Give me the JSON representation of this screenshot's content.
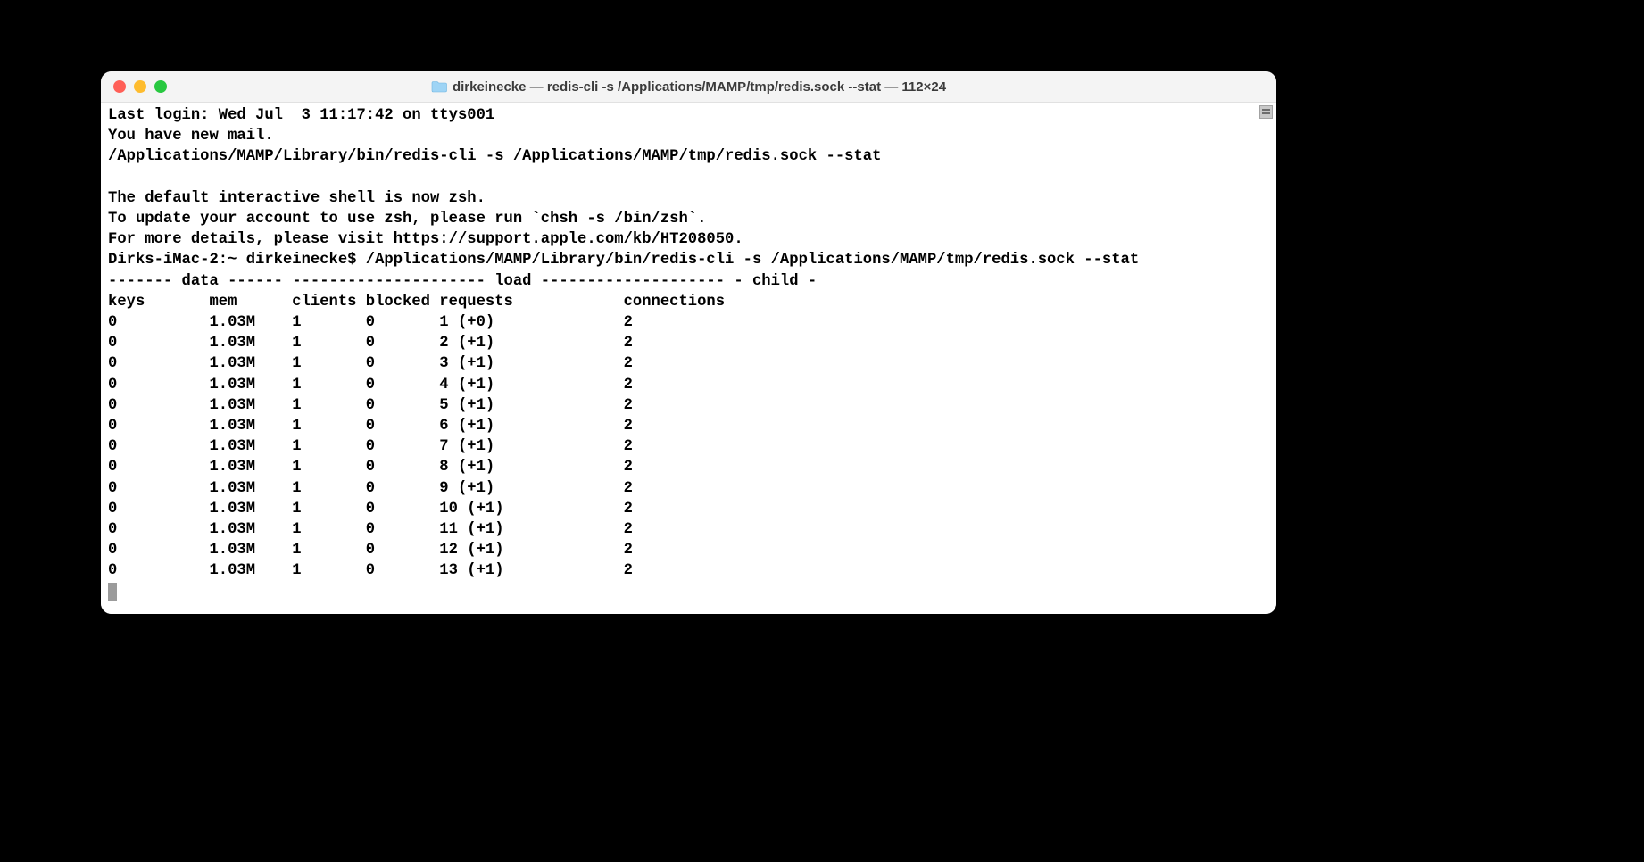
{
  "window": {
    "title": "dirkeinecke — redis-cli -s /Applications/MAMP/tmp/redis.sock --stat — 112×24"
  },
  "terminal": {
    "last_login": "Last login: Wed Jul  3 11:17:42 on ttys001",
    "mail_notice": "You have new mail.",
    "prev_cmd_path": "/Applications/MAMP/Library/bin/redis-cli -s /Applications/MAMP/tmp/redis.sock --stat",
    "zsh_notice_1": "The default interactive shell is now zsh.",
    "zsh_notice_2": "To update your account to use zsh, please run `chsh -s /bin/zsh`.",
    "zsh_notice_3": "For more details, please visit https://support.apple.com/kb/HT208050.",
    "prompt_line": "Dirks-iMac-2:~ dirkeinecke$ /Applications/MAMP/Library/bin/redis-cli -s /Applications/MAMP/tmp/redis.sock --stat",
    "section_divider": "------- data ------ --------------------- load -------------------- - child -",
    "header_row": "keys       mem      clients blocked requests            connections          ",
    "rows": [
      "0          1.03M    1       0       1 (+0)              2           ",
      "0          1.03M    1       0       2 (+1)              2           ",
      "0          1.03M    1       0       3 (+1)              2           ",
      "0          1.03M    1       0       4 (+1)              2           ",
      "0          1.03M    1       0       5 (+1)              2           ",
      "0          1.03M    1       0       6 (+1)              2           ",
      "0          1.03M    1       0       7 (+1)              2           ",
      "0          1.03M    1       0       8 (+1)              2           ",
      "0          1.03M    1       0       9 (+1)              2           ",
      "0          1.03M    1       0       10 (+1)             2           ",
      "0          1.03M    1       0       11 (+1)             2           ",
      "0          1.03M    1       0       12 (+1)             2           ",
      "0          1.03M    1       0       13 (+1)             2           "
    ]
  }
}
